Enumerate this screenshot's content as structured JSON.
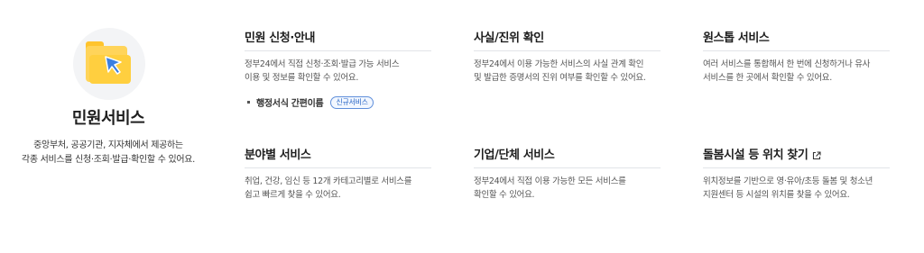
{
  "intro": {
    "title": "민원서비스",
    "description": "중앙부처, 공공기관, 지자체에서 제공하는\n각종 서비스를 신청·조회·발급·확인할 수 있어요."
  },
  "cards": [
    {
      "title": "민원 신청·안내",
      "description": "정부24에서 직접 신청·조회·발급 가능 서비스\n이용 및 정보를 확인할 수 있어요.",
      "sublink": {
        "label": "행정서식 간편이름",
        "badge": "신규서비스"
      }
    },
    {
      "title": "사실/진위 확인",
      "description": "정부24에서 이용 가능한 서비스의 사실 관계 확인\n및 발급한 증명서의 진위 여부를 확인할 수 있어요."
    },
    {
      "title": "원스톱 서비스",
      "description": "여러 서비스를 통합해서 한 번에 신청하거나 유사\n서비스를 한 곳에서 확인할 수 있어요."
    },
    {
      "title": "분야별 서비스",
      "description": "취업, 건강, 임신 등 12개 카테고리별로 서비스를\n쉽고 빠르게 찾을 수 있어요."
    },
    {
      "title": "기업/단체 서비스",
      "description": "정부24에서 직접 이용 가능한 모든 서비스를\n확인할 수 있어요."
    },
    {
      "title": "돌봄시설 등 위치 찾기",
      "description": "위치정보를 기반으로 영·유아/초등 돌봄 및 청소년\n지원센터 등 시설의 위치를 찾을 수 있어요.",
      "icon": "external-link-icon"
    }
  ],
  "colors": {
    "accent": "#2563c4",
    "folder": "#ffcf3f",
    "cursor": "#3b7fe0"
  }
}
